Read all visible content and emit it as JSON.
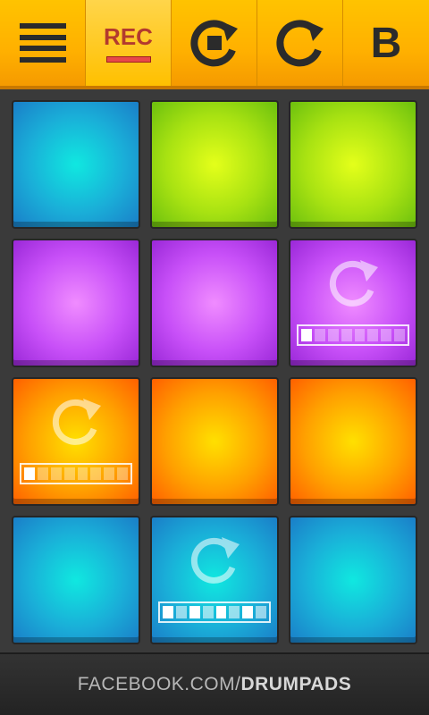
{
  "toolbar": {
    "menu_icon": "hamburger-menu-icon",
    "rec_label": "REC",
    "stop_icon": "loop-stop-icon",
    "redo_icon": "redo-icon",
    "b_label": "B",
    "accent": "#ffb000",
    "rec_color": "#b33a2e"
  },
  "pads": [
    {
      "color": "blue"
    },
    {
      "color": "green"
    },
    {
      "color": "green"
    },
    {
      "color": "purple"
    },
    {
      "color": "purple"
    },
    {
      "color": "purple",
      "loop": true,
      "progress_cells": 8,
      "progress_active": 1
    },
    {
      "color": "orange",
      "loop": true,
      "progress_cells": 8,
      "progress_active": 1
    },
    {
      "color": "orange"
    },
    {
      "color": "orange"
    },
    {
      "color": "blue"
    },
    {
      "color": "blue",
      "loop": true,
      "progress_cells": 8,
      "progress_active": 8
    },
    {
      "color": "blue"
    }
  ],
  "footer": {
    "prefix": "FACEBOOK.COM/",
    "suffix": "DRUMPADS"
  }
}
